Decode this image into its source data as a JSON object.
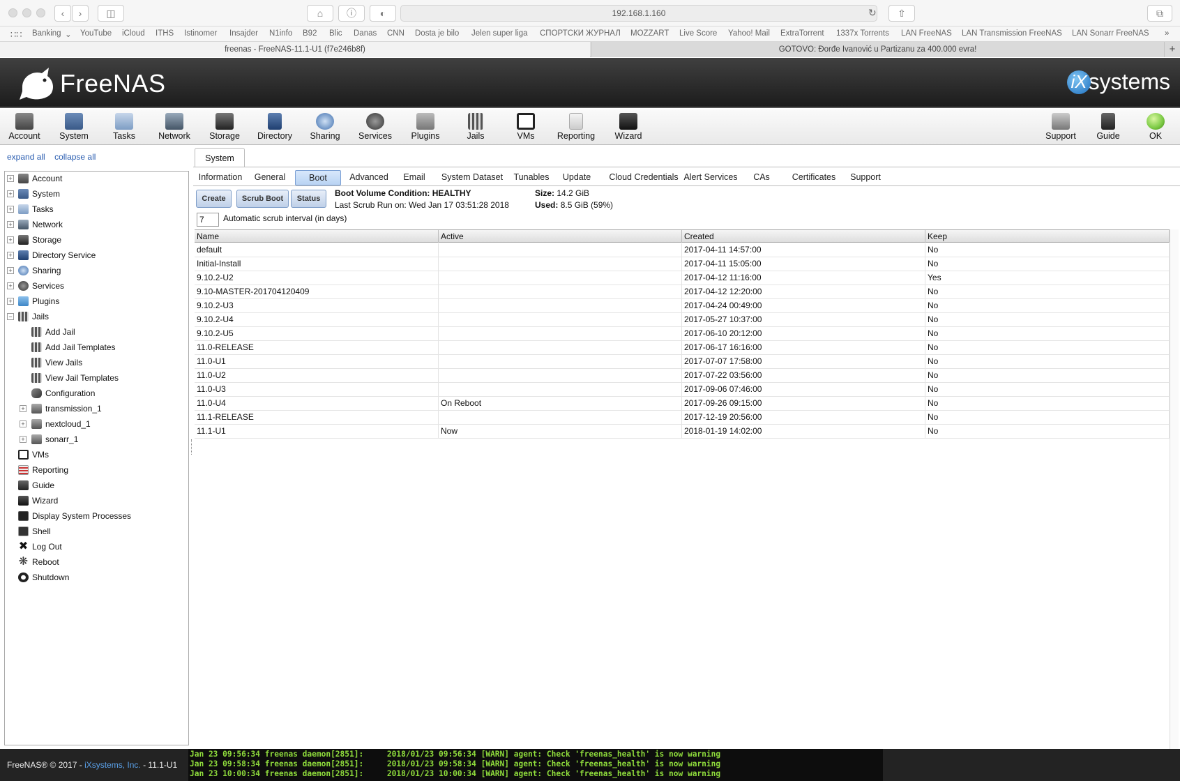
{
  "browser": {
    "url": "192.168.1.160",
    "bookmarks": [
      "Banking",
      "YouTube",
      "iCloud",
      "ITHS",
      "Istinomer",
      "Insajder",
      "N1info",
      "B92",
      "Blic",
      "Danas",
      "CNN",
      "Dosta je bilo",
      "Jelen super liga",
      "СПОРТСКИ ЖУРНАЛ",
      "MOZZART",
      "Live Score",
      "Yahoo! Mail",
      "ExtraTorrent",
      "1337x Torrents",
      "LAN FreeNAS",
      "LAN Transmission FreeNAS",
      "LAN Sonarr FreeNAS"
    ],
    "tabs": [
      "freenas - FreeNAS-11.1-U1 (f7e246b8f)",
      "GOTOVO: Đorđe Ivanović u Partizanu za 400.000 evra!"
    ],
    "new_tab": "+"
  },
  "header": {
    "logo": "FreeNAS",
    "brand": "systems",
    "brand_mark": "iX"
  },
  "nav": {
    "items": [
      "Account",
      "System",
      "Tasks",
      "Network",
      "Storage",
      "Directory",
      "Sharing",
      "Services",
      "Plugins",
      "Jails",
      "VMs",
      "Reporting",
      "Wizard"
    ],
    "right": [
      "Support",
      "Guide",
      "OK"
    ]
  },
  "tree": {
    "expand_all": "expand all",
    "collapse_all": "collapse all",
    "top": [
      "Account",
      "System",
      "Tasks",
      "Network",
      "Storage",
      "Directory Service",
      "Sharing",
      "Services",
      "Plugins",
      "Jails"
    ],
    "jails_children": [
      "Add Jail",
      "Add Jail Templates",
      "View Jails",
      "View Jail Templates",
      "Configuration"
    ],
    "jail_instances": [
      "transmission_1",
      "nextcloud_1",
      "sonarr_1"
    ],
    "bottom": [
      "VMs",
      "Reporting",
      "Guide",
      "Wizard",
      "Display System Processes",
      "Shell",
      "Log Out",
      "Reboot",
      "Shutdown"
    ]
  },
  "system": {
    "tab": "System",
    "subtabs": [
      "Information",
      "General",
      "Boot",
      "Advanced",
      "Email",
      "System Dataset",
      "Tunables",
      "Update",
      "Cloud Credentials",
      "Alert Services",
      "CAs",
      "Certificates",
      "Support"
    ],
    "selected_subtab": "Boot",
    "buttons": [
      "Create",
      "Scrub Boot",
      "Status"
    ],
    "condition_label": "Boot Volume Condition:",
    "condition_value": "HEALTHY",
    "last_scrub": "Last Scrub Run on: Wed Jan 17 03:51:28 2018",
    "size_label": "Size:",
    "size_value": "14.2 GiB",
    "used_label": "Used:",
    "used_value": "8.5 GiB (59%)",
    "interval_value": "7",
    "interval_label": "Automatic scrub interval (in days)"
  },
  "table": {
    "columns": [
      "Name",
      "Active",
      "Created",
      "Keep"
    ],
    "rows": [
      [
        "default",
        "",
        "2017-04-11 14:57:00",
        "No"
      ],
      [
        "Initial-Install",
        "",
        "2017-04-11 15:05:00",
        "No"
      ],
      [
        "9.10.2-U2",
        "",
        "2017-04-12 11:16:00",
        "Yes"
      ],
      [
        "9.10-MASTER-201704120409",
        "",
        "2017-04-12 12:20:00",
        "No"
      ],
      [
        "9.10.2-U3",
        "",
        "2017-04-24 00:49:00",
        "No"
      ],
      [
        "9.10.2-U4",
        "",
        "2017-05-27 10:37:00",
        "No"
      ],
      [
        "9.10.2-U5",
        "",
        "2017-06-10 20:12:00",
        "No"
      ],
      [
        "11.0-RELEASE",
        "",
        "2017-06-17 16:16:00",
        "No"
      ],
      [
        "11.0-U1",
        "",
        "2017-07-07 17:58:00",
        "No"
      ],
      [
        "11.0-U2",
        "",
        "2017-07-22 03:56:00",
        "No"
      ],
      [
        "11.0-U3",
        "",
        "2017-09-06 07:46:00",
        "No"
      ],
      [
        "11.0-U4",
        "On Reboot",
        "2017-09-26 09:15:00",
        "No"
      ],
      [
        "11.1-RELEASE",
        "",
        "2017-12-19 20:56:00",
        "No"
      ],
      [
        "11.1-U1",
        "Now",
        "2018-01-19 14:02:00",
        "No"
      ]
    ]
  },
  "footer": {
    "copyright": "FreeNAS® © 2017 - ",
    "company": "iXsystems, Inc.",
    "version": " - 11.1-U1",
    "console": [
      "Jan 23 09:56:34 freenas daemon[2851]:     2018/01/23 09:56:34 [WARN] agent: Check 'freenas_health' is now warning",
      "Jan 23 09:58:34 freenas daemon[2851]:     2018/01/23 09:58:34 [WARN] agent: Check 'freenas_health' is now warning",
      "Jan 23 10:00:34 freenas daemon[2851]:     2018/01/23 10:00:34 [WARN] agent: Check 'freenas_health' is now warning"
    ]
  },
  "colors": {
    "header_bg": "#2a2a2a",
    "link": "#2a5db0",
    "console_text": "#8fdc3c",
    "ok_green": "#7ac943"
  }
}
